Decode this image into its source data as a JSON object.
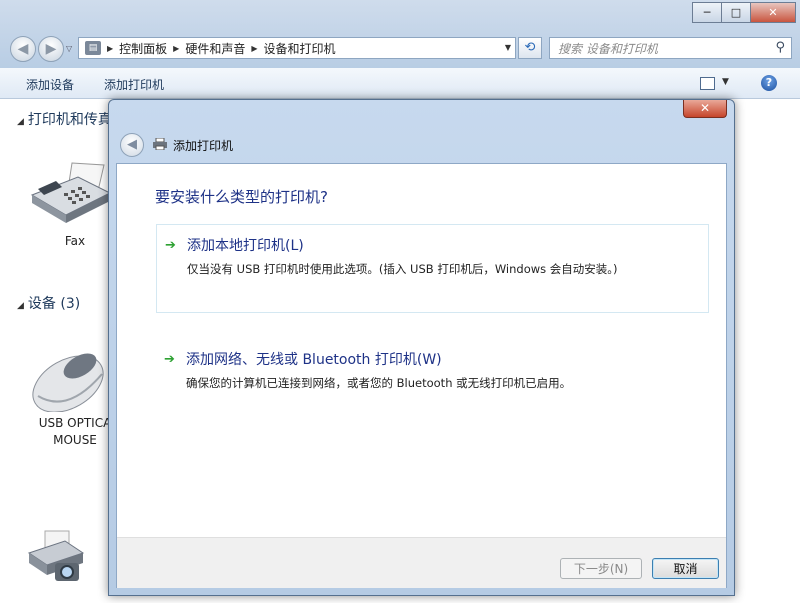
{
  "window": {
    "caption_minimize": "─",
    "caption_maximize": "□",
    "caption_close": "✕"
  },
  "nav": {
    "back_glyph": "◀",
    "forward_glyph": "▶",
    "history_glyph": "▽"
  },
  "address": {
    "breadcrumbs": [
      "控制面板",
      "硬件和声音",
      "设备和打印机"
    ],
    "separator": "▶",
    "dropdown_glyph": "▼",
    "refresh_glyph": "⟲"
  },
  "search": {
    "placeholder": "搜索 设备和打印机",
    "icon_glyph": "⚲"
  },
  "commandbar": {
    "add_device": "添加设备",
    "add_printer": "添加打印机",
    "view_dropdown_glyph": "▼",
    "help_glyph": "?"
  },
  "groups": {
    "printers": {
      "label": "打印机和传真",
      "expand_glyph": "◢"
    },
    "devices": {
      "label": "设备 (3)",
      "expand_glyph": "◢"
    }
  },
  "devices": {
    "fax": "Fax",
    "mouse_line1": "USB OPTICA",
    "mouse_line2": "MOUSE"
  },
  "dialog": {
    "close_glyph": "✕",
    "back_glyph": "◀",
    "title": "添加打印机",
    "heading": "要安装什么类型的打印机?",
    "arrow_glyph": "➔",
    "options": [
      {
        "title": "添加本地打印机(L)",
        "desc": "仅当没有 USB 打印机时使用此选项。(插入 USB 打印机后，Windows 会自动安装。)"
      },
      {
        "title": "添加网络、无线或 Bluetooth 打印机(W)",
        "desc": "确保您的计算机已连接到网络，或者您的 Bluetooth 或无线打印机已启用。"
      }
    ],
    "next_button": "下一步(N)",
    "cancel_button": "取消"
  },
  "colors": {
    "link_blue": "#1e3287",
    "arrow_green": "#2da132",
    "close_red": "#c6452b"
  }
}
